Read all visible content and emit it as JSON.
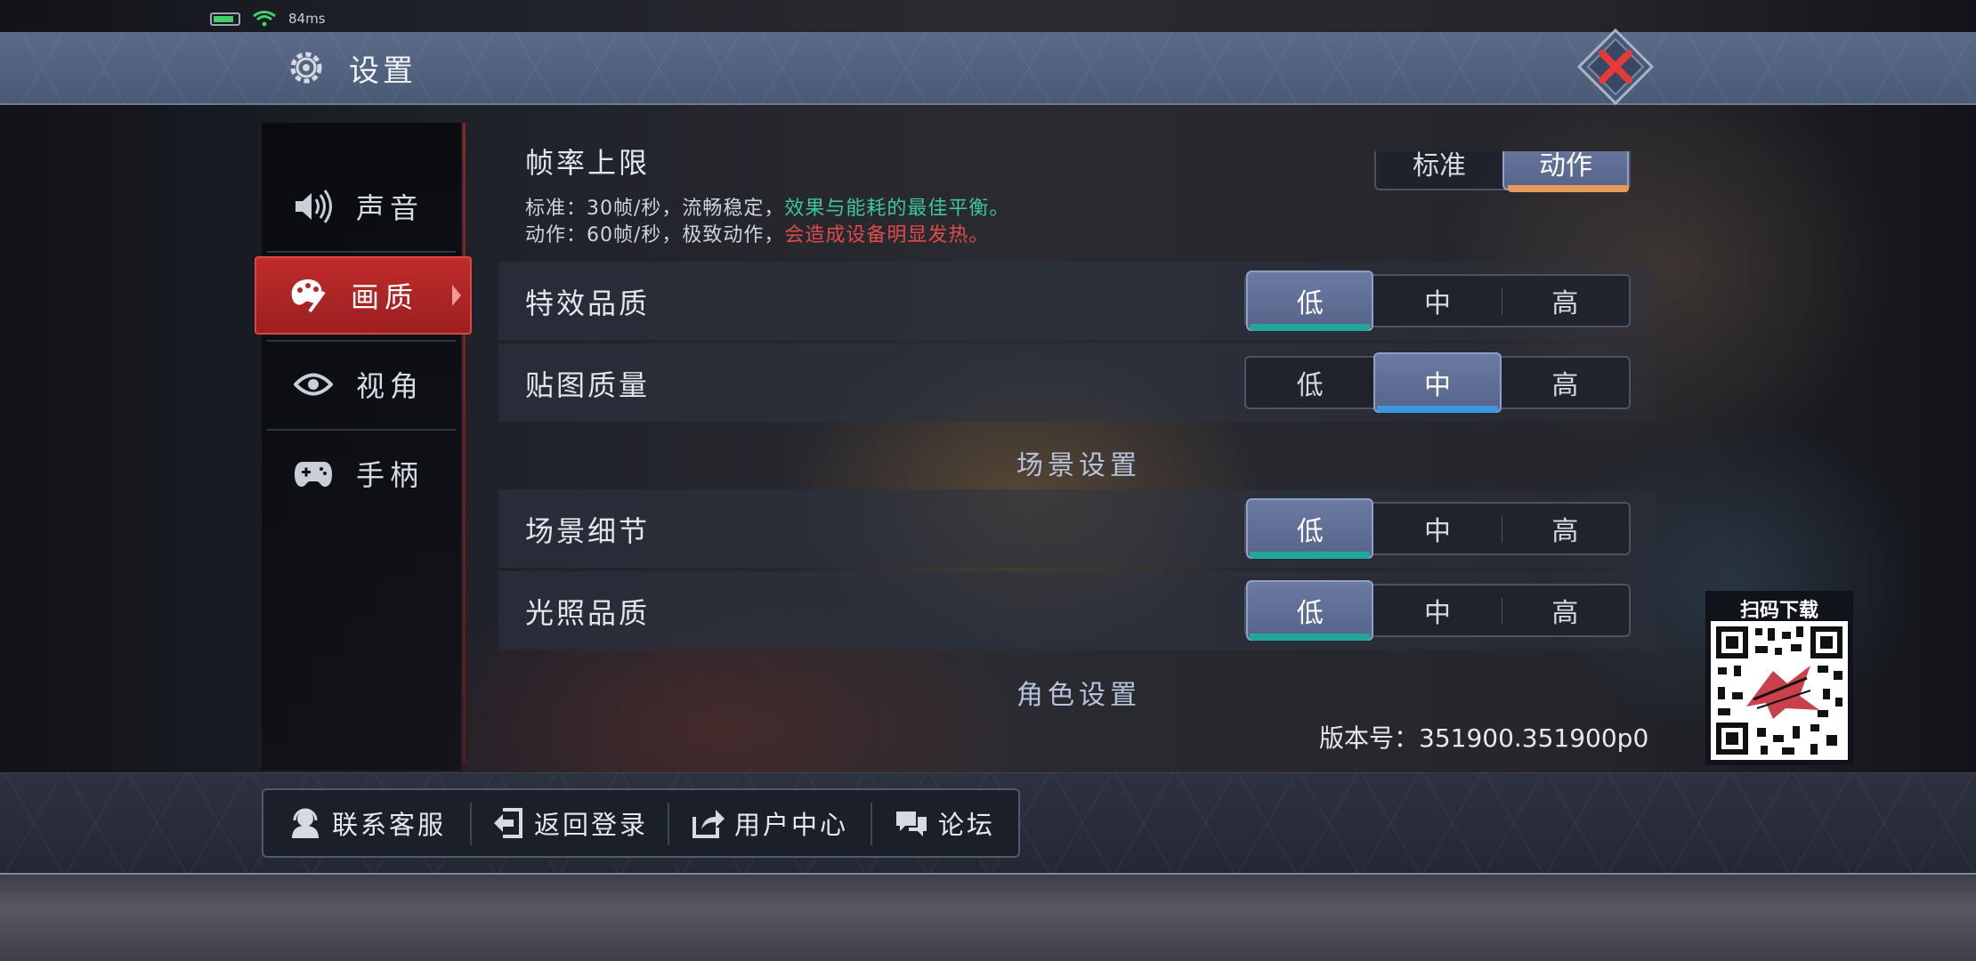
{
  "status_bar": {
    "ping": "84ms"
  },
  "header": {
    "title": "设置"
  },
  "nav": {
    "items": [
      {
        "label": "声音",
        "icon": "speaker-icon"
      },
      {
        "label": "画质",
        "icon": "paint-palette-icon",
        "active": true
      },
      {
        "label": "视角",
        "icon": "eye-icon"
      },
      {
        "label": "手柄",
        "icon": "gamepad-icon"
      }
    ]
  },
  "settings": {
    "frame_rate": {
      "label": "帧率上限",
      "options": [
        "标准",
        "动作"
      ],
      "selected": "动作",
      "desc1_prefix": "标准：30帧/秒，流畅稳定，",
      "desc1_highlight": "效果与能耗的最佳平衡。",
      "desc2_prefix": "动作：60帧/秒，极致动作，",
      "desc2_highlight": "会造成设备明显发热。"
    },
    "effects_quality": {
      "label": "特效品质",
      "options": [
        "低",
        "中",
        "高"
      ],
      "selected": "低"
    },
    "texture_quality": {
      "label": "贴图质量",
      "options": [
        "低",
        "中",
        "高"
      ],
      "selected": "中"
    },
    "scene_section": "场景设置",
    "scene_detail": {
      "label": "场景细节",
      "options": [
        "低",
        "中",
        "高"
      ],
      "selected": "低"
    },
    "lighting_quality": {
      "label": "光照品质",
      "options": [
        "低",
        "中",
        "高"
      ],
      "selected": "低"
    },
    "character_section": "角色设置"
  },
  "version": "版本号：351900.351900p0",
  "qr": {
    "label": "扫码下载"
  },
  "bottom": {
    "customer_service": "联系客服",
    "back_to_login": "返回登录",
    "user_center": "用户中心",
    "forum": "论坛"
  },
  "colors": {
    "accent_red": "#c02b2b",
    "teal_underline": "#22a79a",
    "blue_underline": "#3d96e0",
    "orange_underline": "#e39a5c",
    "desc_green": "#3fc59b",
    "desc_red": "#e24a4a"
  }
}
